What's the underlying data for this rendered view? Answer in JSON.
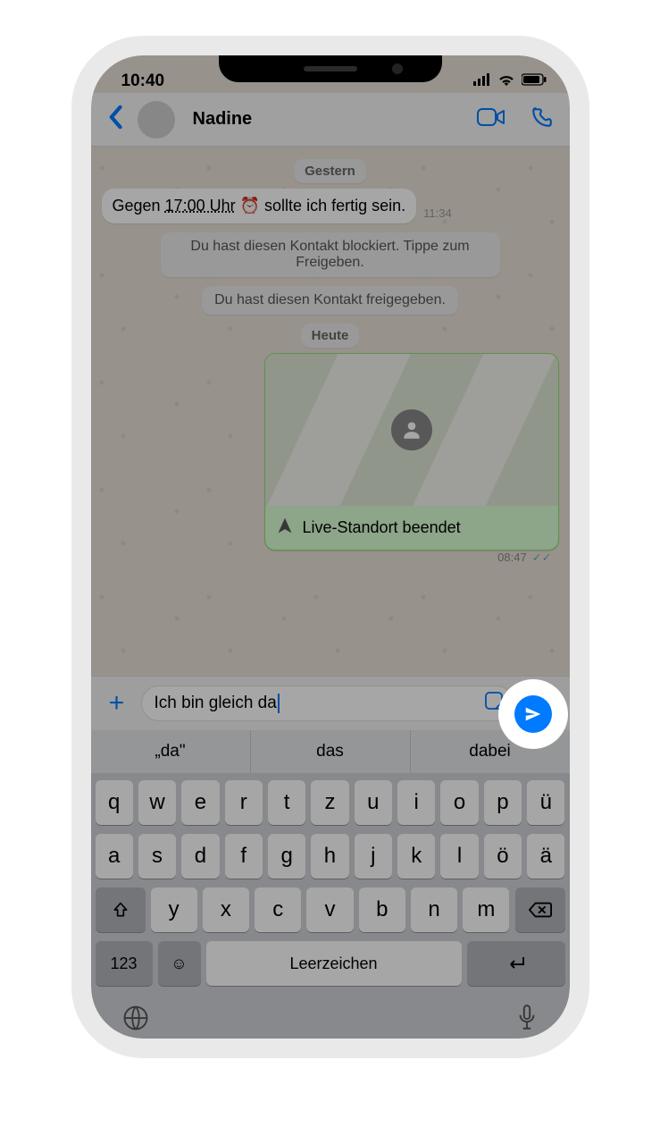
{
  "status": {
    "time": "10:40"
  },
  "header": {
    "contact_name": "Nadine"
  },
  "chat": {
    "date1": "Gestern",
    "incoming1_prefix": "Gegen ",
    "incoming1_time_text": "17:00 Uhr",
    "incoming1_emoji": "⏰",
    "incoming1_suffix": " sollte ich fertig sein.",
    "incoming1_ts": "11:34",
    "system1": "Du hast diesen Kontakt blockiert. Tippe zum Freigeben.",
    "system2": "Du hast diesen Kontakt freigegeben.",
    "date2": "Heute",
    "location_text": "Live-Standort beendet",
    "outgoing_ts": "08:47"
  },
  "input": {
    "text": "Ich bin gleich da"
  },
  "suggestions": {
    "s1": "„da\"",
    "s2": "das",
    "s3": "dabei"
  },
  "keyboard": {
    "row1": [
      "q",
      "w",
      "e",
      "r",
      "t",
      "z",
      "u",
      "i",
      "o",
      "p",
      "ü"
    ],
    "row2": [
      "a",
      "s",
      "d",
      "f",
      "g",
      "h",
      "j",
      "k",
      "l",
      "ö",
      "ä"
    ],
    "row3": [
      "y",
      "x",
      "c",
      "v",
      "b",
      "n",
      "m"
    ],
    "k123": "123",
    "space": "Leerzeichen"
  }
}
